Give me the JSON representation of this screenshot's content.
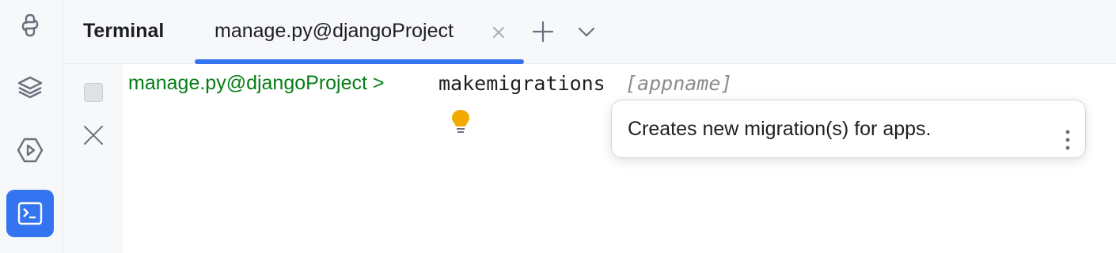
{
  "sidebar": {
    "items": [
      {
        "name": "python-icon"
      },
      {
        "name": "layers-icon"
      },
      {
        "name": "run-icon"
      },
      {
        "name": "terminal-icon",
        "active": true
      }
    ]
  },
  "header": {
    "title": "Terminal",
    "tab_label": "manage.py@djangoProject"
  },
  "terminal": {
    "prompt": "manage.py@djangoProject >",
    "command": "makemigrations",
    "argument": "[appname]"
  },
  "popup": {
    "text": "Creates new migration(s) for apps."
  },
  "colors": {
    "accent": "#3574f0",
    "prompt": "#067d17",
    "hint": "#8c8c8c",
    "bulb": "#f2a900"
  }
}
